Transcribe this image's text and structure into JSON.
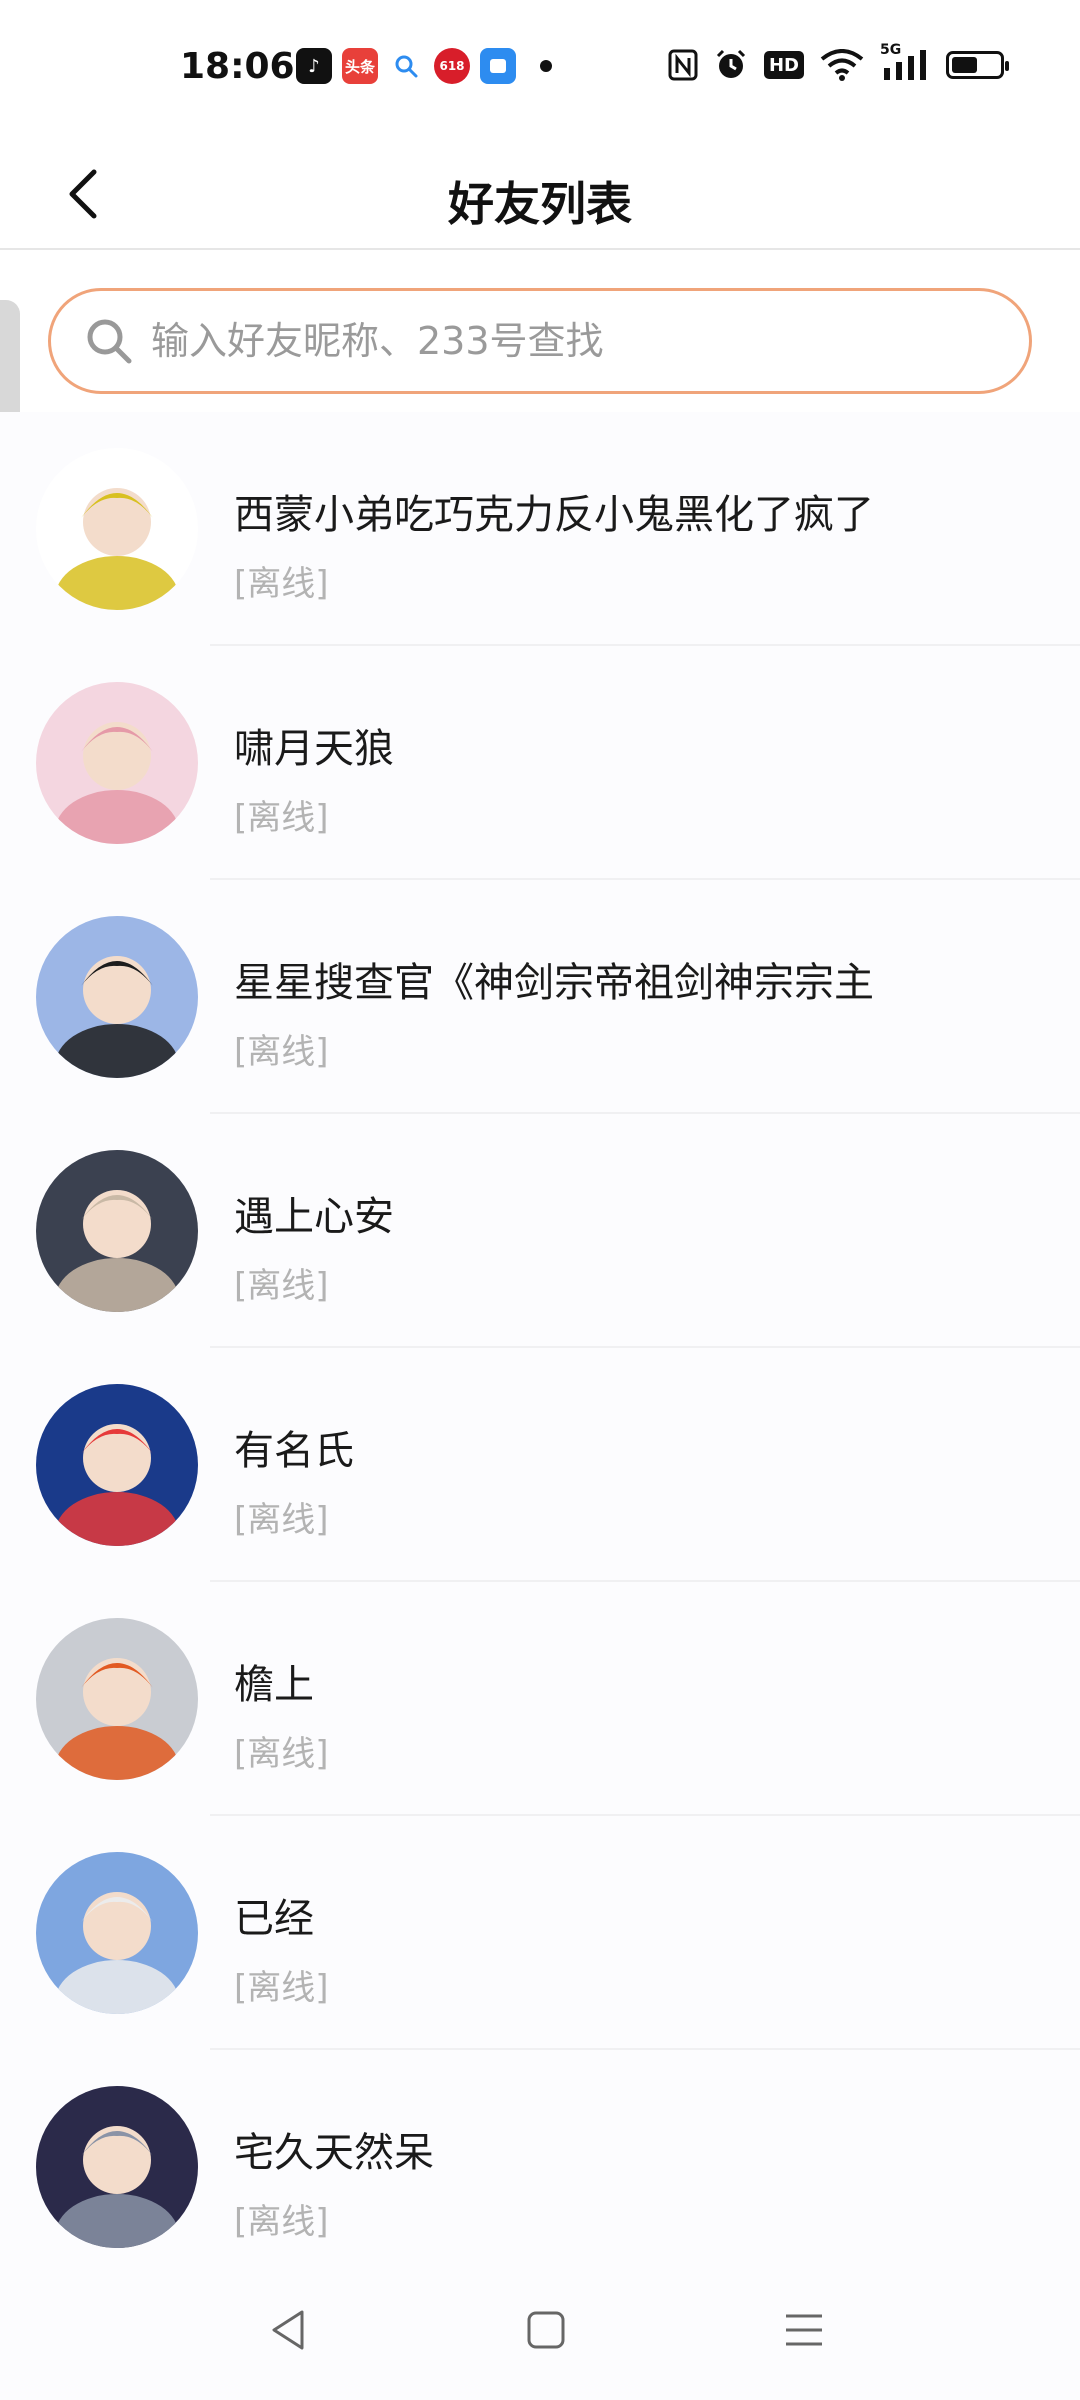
{
  "status_bar": {
    "time": "18:06",
    "notification_apps": [
      {
        "name": "tiktok-icon",
        "glyph": "♪",
        "color": "#111111"
      },
      {
        "name": "toutiao-icon",
        "glyph": "头条",
        "color": "#e8403a"
      },
      {
        "name": "search-app-icon",
        "glyph": "🔍",
        "color": "#ffffff"
      },
      {
        "name": "jd-618-icon",
        "glyph": "618",
        "color": "#d81e2a"
      },
      {
        "name": "messenger-app-icon",
        "glyph": "▢",
        "color": "#2d8cf0"
      }
    ],
    "system_icons": [
      "nfc-icon",
      "alarm-icon",
      "hd-icon",
      "wifi-icon",
      "signal-5g-icon"
    ],
    "hd_label": "HD",
    "signal_label": "5G",
    "battery_level": 0.55
  },
  "header": {
    "title": "好友列表"
  },
  "search": {
    "placeholder": "输入好友昵称、233号查找",
    "value": ""
  },
  "friends": [
    {
      "name": "西蒙小弟吃巧克力反小鬼黑化了疯了",
      "status": "[离线]",
      "avatar_colors": [
        "#ffffff",
        "#d8c020"
      ]
    },
    {
      "name": "啸月天狼",
      "status": "[离线]",
      "avatar_colors": [
        "#f4d6e0",
        "#e59aa8"
      ]
    },
    {
      "name": "星星搜查官《神剑宗帝祖剑神宗宗主",
      "status": "[离线]",
      "avatar_colors": [
        "#9cb6e6",
        "#1d1d1d"
      ]
    },
    {
      "name": "遇上心安",
      "status": "[离线]",
      "avatar_colors": [
        "#3b4150",
        "#c9b9a6"
      ]
    },
    {
      "name": "有名氏",
      "status": "[离线]",
      "avatar_colors": [
        "#1a3a8a",
        "#e63a3a"
      ]
    },
    {
      "name": "檐上",
      "status": "[离线]",
      "avatar_colors": [
        "#c9ccd2",
        "#e25a22"
      ]
    },
    {
      "name": "已经",
      "status": "[离线]",
      "avatar_colors": [
        "#7ea6e0",
        "#ececec"
      ]
    },
    {
      "name": "宅久天然呆",
      "status": "[离线]",
      "avatar_colors": [
        "#2b2a4a",
        "#8a93a6"
      ]
    }
  ],
  "accent_color": "#f0a47a"
}
